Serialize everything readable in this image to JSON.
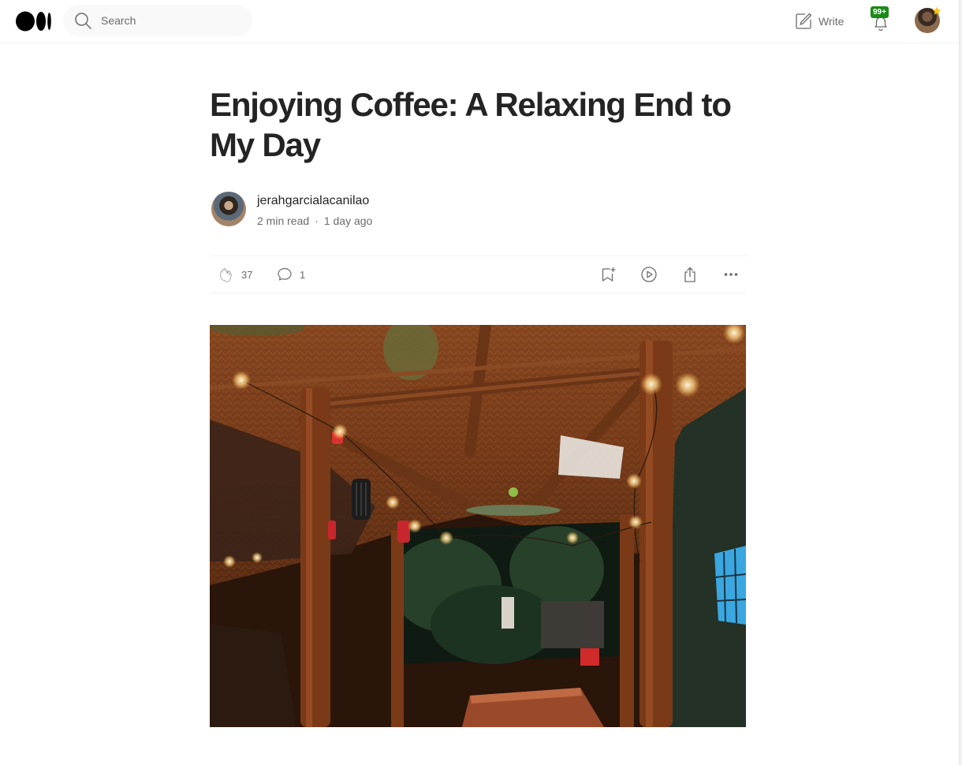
{
  "header": {
    "search_placeholder": "Search",
    "write_label": "Write",
    "notifications_count": "99+",
    "colors": {
      "badge": "#1a8917",
      "star": "#ffc017"
    }
  },
  "article": {
    "title": "Enjoying Coffee: A Relaxing End to My Day",
    "author": "jerahgarcialacanilao",
    "read_time": "2 min read",
    "separator": "·",
    "published": "1 day ago",
    "claps": "37",
    "responses": "1"
  },
  "icons": [
    "medium-logo-icon",
    "search-icon",
    "write-icon",
    "bell-icon",
    "star-icon",
    "clap-icon",
    "comment-icon",
    "bookmark-add-icon",
    "play-icon",
    "share-icon",
    "more-icon"
  ]
}
